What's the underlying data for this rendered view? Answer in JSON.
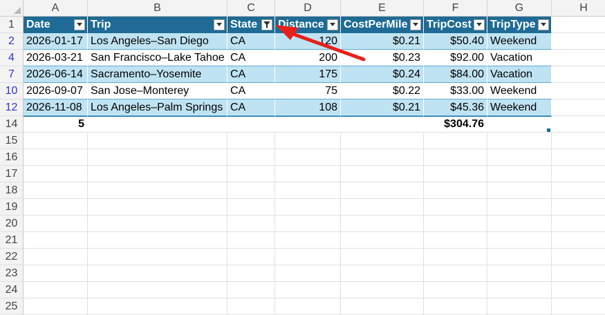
{
  "columns": [
    "A",
    "B",
    "C",
    "D",
    "E",
    "F",
    "G",
    "H"
  ],
  "row_numbers": [
    "1",
    "2",
    "4",
    "7",
    "10",
    "12",
    "14",
    "15",
    "16",
    "17",
    "18",
    "19",
    "20",
    "21",
    "22",
    "23",
    "24",
    "25"
  ],
  "filtered_rows": [
    "2",
    "4",
    "7",
    "10",
    "12"
  ],
  "table": {
    "headers": [
      "Date",
      "Trip",
      "State",
      "Distance",
      "CostPerMile",
      "TripCost",
      "TripType"
    ],
    "filter_active_column": "State",
    "rows": [
      [
        "2026-01-17",
        "Los Angeles–San Diego",
        "CA",
        "120",
        "$0.21",
        "$50.40",
        "Weekend"
      ],
      [
        "2026-03-21",
        "San Francisco–Lake Tahoe",
        "CA",
        "200",
        "$0.23",
        "$92.00",
        "Vacation"
      ],
      [
        "2026-06-14",
        "Sacramento–Yosemite",
        "CA",
        "175",
        "$0.24",
        "$84.00",
        "Vacation"
      ],
      [
        "2026-09-07",
        "San Jose–Monterey",
        "CA",
        "75",
        "$0.22",
        "$33.00",
        "Weekend"
      ],
      [
        "2026-11-08",
        "Los Angeles–Palm Springs",
        "CA",
        "108",
        "$0.21",
        "$45.36",
        "Weekend"
      ]
    ],
    "totals": {
      "count": "5",
      "trip_cost": "$304.76"
    }
  },
  "colors": {
    "header": "#1f6b95",
    "band": "#c0e3f3",
    "arrow": "#e8201a",
    "row_number_filtered": "#2f36c9"
  },
  "icons": {
    "filter_dropdown": "chevron-down-icon",
    "filter_applied": "funnel-icon",
    "annotation": "red-arrow"
  }
}
